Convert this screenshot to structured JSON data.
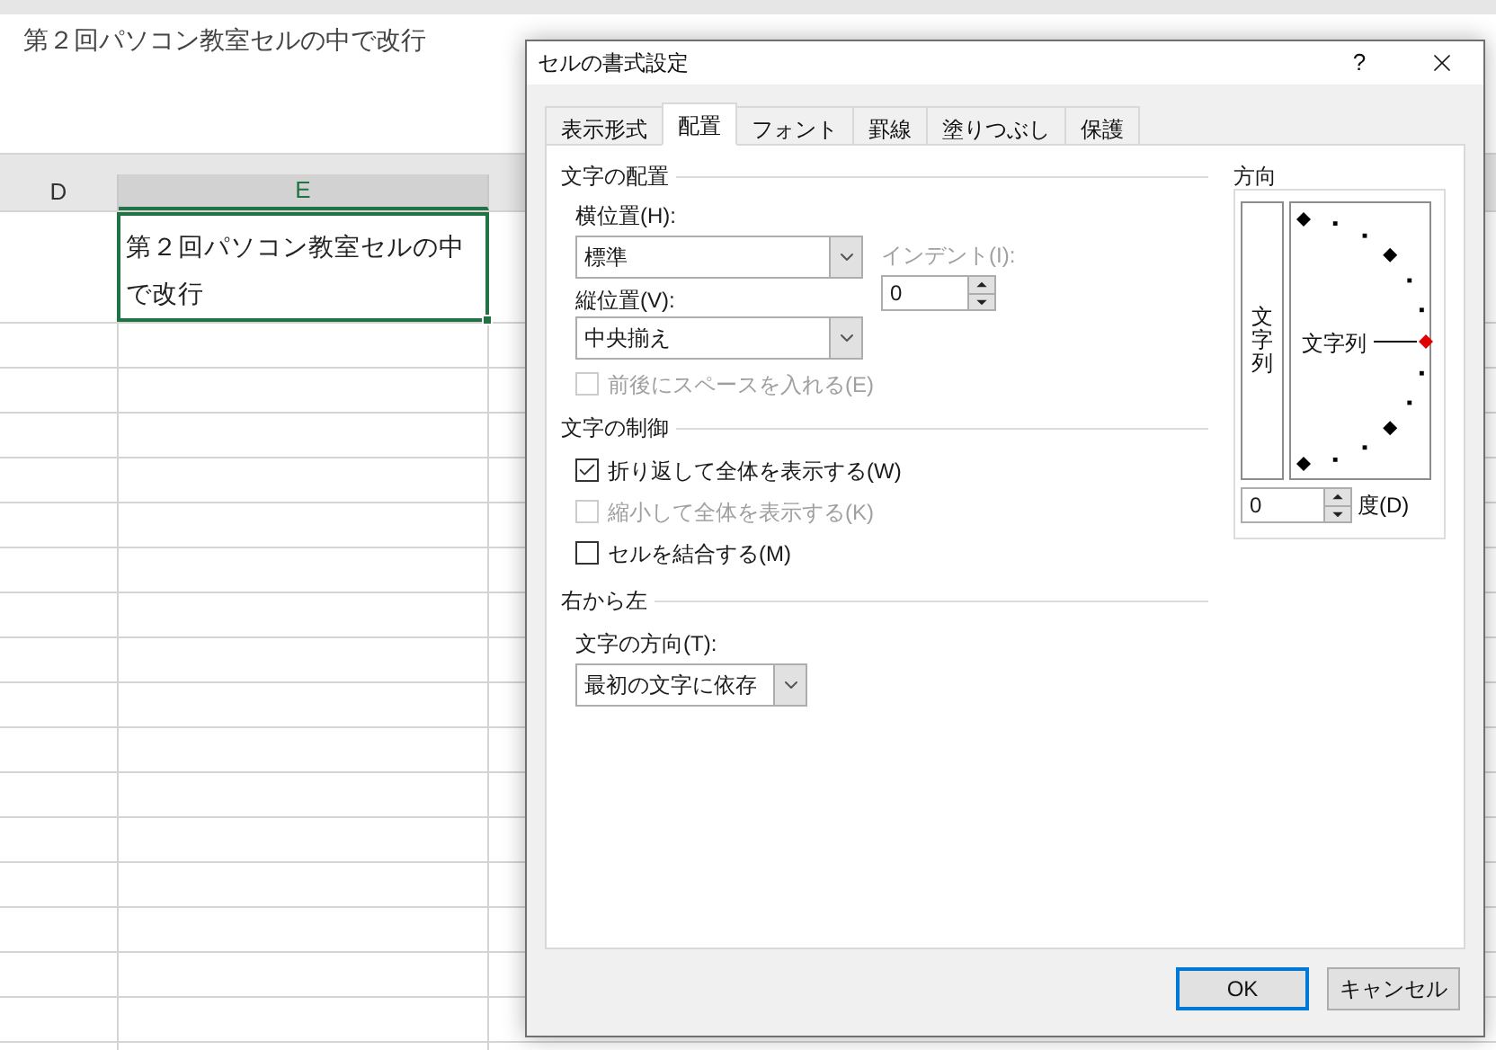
{
  "formula_bar": {
    "text": "第２回パソコン教室セルの中で改行"
  },
  "sheet": {
    "columns": [
      {
        "label": "D",
        "selected": false
      },
      {
        "label": "E",
        "selected": true
      }
    ],
    "active_cell": {
      "text": "第２回パソコン教室セルの中で改行"
    }
  },
  "dialog": {
    "title": "セルの書式設定",
    "help": "?",
    "tabs": [
      {
        "label": "表示形式",
        "selected": false
      },
      {
        "label": "配置",
        "selected": true
      },
      {
        "label": "フォント",
        "selected": false
      },
      {
        "label": "罫線",
        "selected": false
      },
      {
        "label": "塗りつぶし",
        "selected": false
      },
      {
        "label": "保護",
        "selected": false
      }
    ],
    "text_alignment": {
      "title": "文字の配置",
      "horizontal": {
        "label": "横位置(H):",
        "value": "標準"
      },
      "vertical": {
        "label": "縦位置(V):",
        "value": "中央揃え"
      },
      "indent": {
        "label": "インデント(I):",
        "value": "0",
        "disabled": true
      },
      "distributed": {
        "label": "前後にスペースを入れる(E)",
        "checked": false,
        "disabled": true
      }
    },
    "text_control": {
      "title": "文字の制御",
      "options": [
        {
          "label": "折り返して全体を表示する(W)",
          "checked": true,
          "disabled": false
        },
        {
          "label": "縮小して全体を表示する(K)",
          "checked": false,
          "disabled": true
        },
        {
          "label": "セルを結合する(M)",
          "checked": false,
          "disabled": false
        }
      ]
    },
    "right_to_left": {
      "title": "右から左",
      "direction": {
        "label": "文字の方向(T):",
        "value": "最初の文字に依存"
      }
    },
    "orientation": {
      "title": "方向",
      "vertical_text": "文字列",
      "horizontal_text": "文字列",
      "degrees": {
        "value": "0",
        "label": "度(D)"
      }
    },
    "buttons": [
      {
        "label": "OK",
        "default": true
      },
      {
        "label": "キャンセル",
        "default": false
      }
    ]
  }
}
